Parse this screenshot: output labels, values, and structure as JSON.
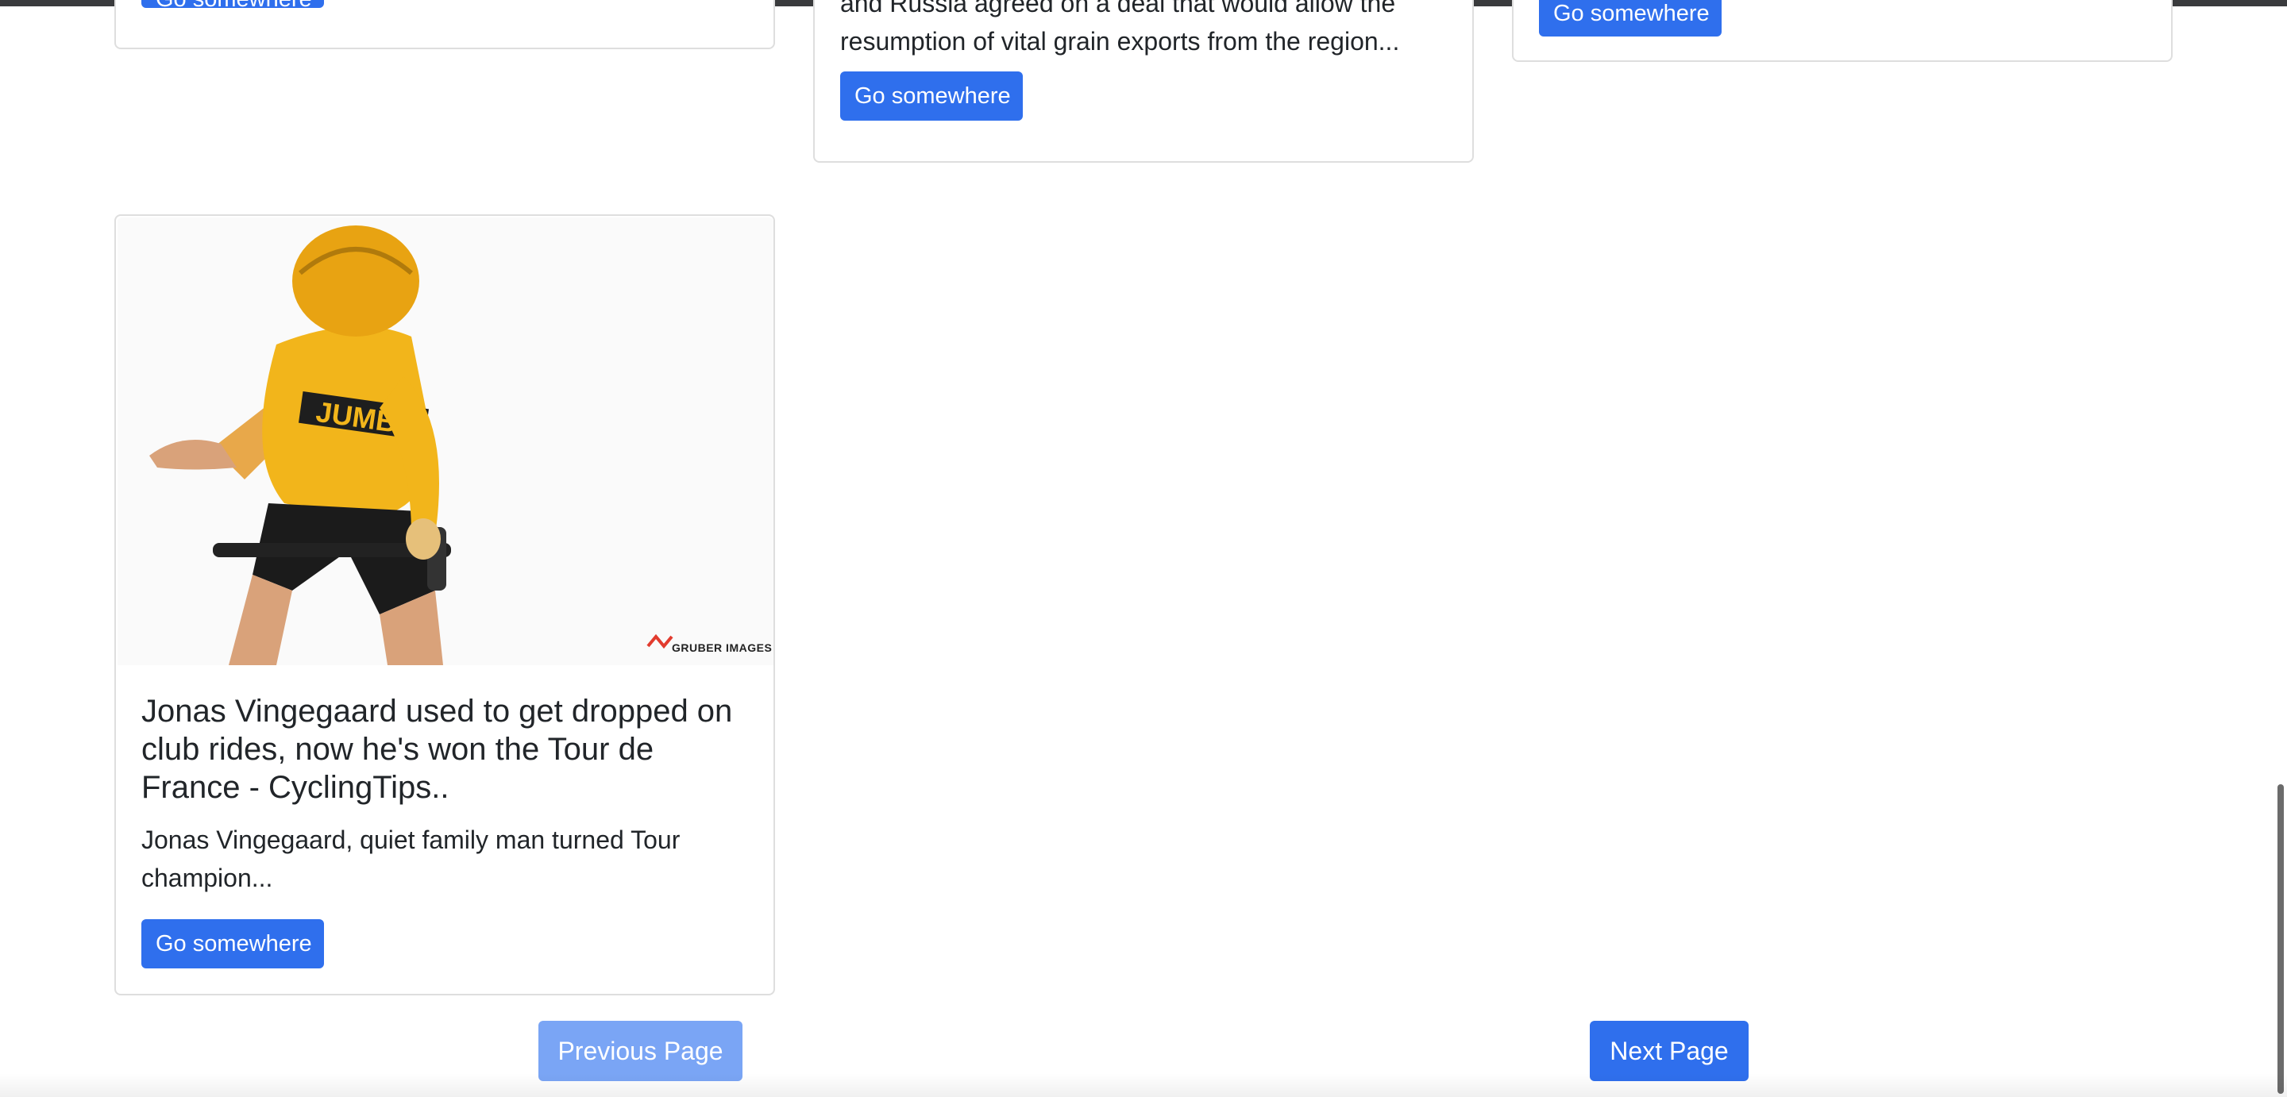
{
  "cards_top": {
    "left": {
      "button_label": "Go somewhere"
    },
    "middle": {
      "text_line1": "and Russia agreed on a deal that would allow the",
      "text_line2": "resumption of vital grain exports from the region...",
      "button_label": "Go somewhere"
    },
    "right": {
      "button_label": "Go somewhere"
    }
  },
  "featured_card": {
    "image_alt": "Cyclist in yellow Jumbo-Visma jersey",
    "image_watermark": "GRUBER IMAGES",
    "title": "Jonas Vingegaard used to get dropped on club rides, now he's won the Tour de France - CyclingTips..",
    "text": "Jonas Vingegaard, quiet family man turned Tour champion...",
    "button_label": "Go somewhere"
  },
  "pagination": {
    "previous_label": "Previous Page",
    "next_label": "Next Page"
  },
  "colors": {
    "primary": "#2f6fed",
    "primary_disabled": "#7aa5f5",
    "jersey_yellow": "#f2b51b"
  }
}
